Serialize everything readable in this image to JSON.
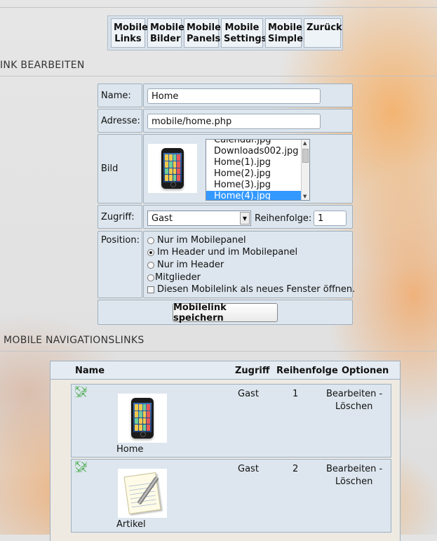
{
  "menu": {
    "items": [
      {
        "line1": "Mobile",
        "line2": "Links"
      },
      {
        "line1": "Mobile",
        "line2": "Bilder"
      },
      {
        "line1": "Mobile",
        "line2": "Panels"
      },
      {
        "line1": "Mobile",
        "line2": "Settings"
      },
      {
        "line1": "Mobile",
        "line2": "Simple"
      },
      {
        "line1": "Zurück",
        "line2": ""
      }
    ]
  },
  "edit_section": {
    "title": "INK BEARBEITEN",
    "name_label": "Name:",
    "name_value": "Home",
    "address_label": "Adresse:",
    "address_value": "mobile/home.php",
    "image_label": "Bild",
    "image_options": [
      "Calendar.jpg",
      "Downloads002.jpg",
      "Home(1).jpg",
      "Home(2).jpg",
      "Home(3).jpg",
      "Home(4).jpg"
    ],
    "image_selected": "Home(4).jpg",
    "access_label": "Zugriff:",
    "access_value": "Gast",
    "order_label": "Reihenfolge:",
    "order_value": "1",
    "position_label": "Position:",
    "position_options": [
      "Nur im Mobilepanel",
      "Im Header und im Mobilepanel",
      "Nur im Header",
      "Mitglieder"
    ],
    "position_selected": "Im Header und im Mobilepanel",
    "new_window_label": "Diesen Mobilelink als neues Fenster öffnen.",
    "save_label": "Mobilelink speichern"
  },
  "nav_section": {
    "title": "MOBILE NAVIGATIONSLINKS",
    "headers": {
      "name": "Name",
      "access": "Zugriff",
      "order": "Reihenfolge",
      "options": "Optionen"
    },
    "rows": [
      {
        "name": "Home",
        "icon": "phone-icon",
        "access": "Gast",
        "order": "1",
        "edit": "Bearbeiten -",
        "delete": "Löschen"
      },
      {
        "name": "Artikel",
        "icon": "notepad-icon",
        "access": "Gast",
        "order": "2",
        "edit": "Bearbeiten -",
        "delete": "Löschen"
      }
    ]
  }
}
